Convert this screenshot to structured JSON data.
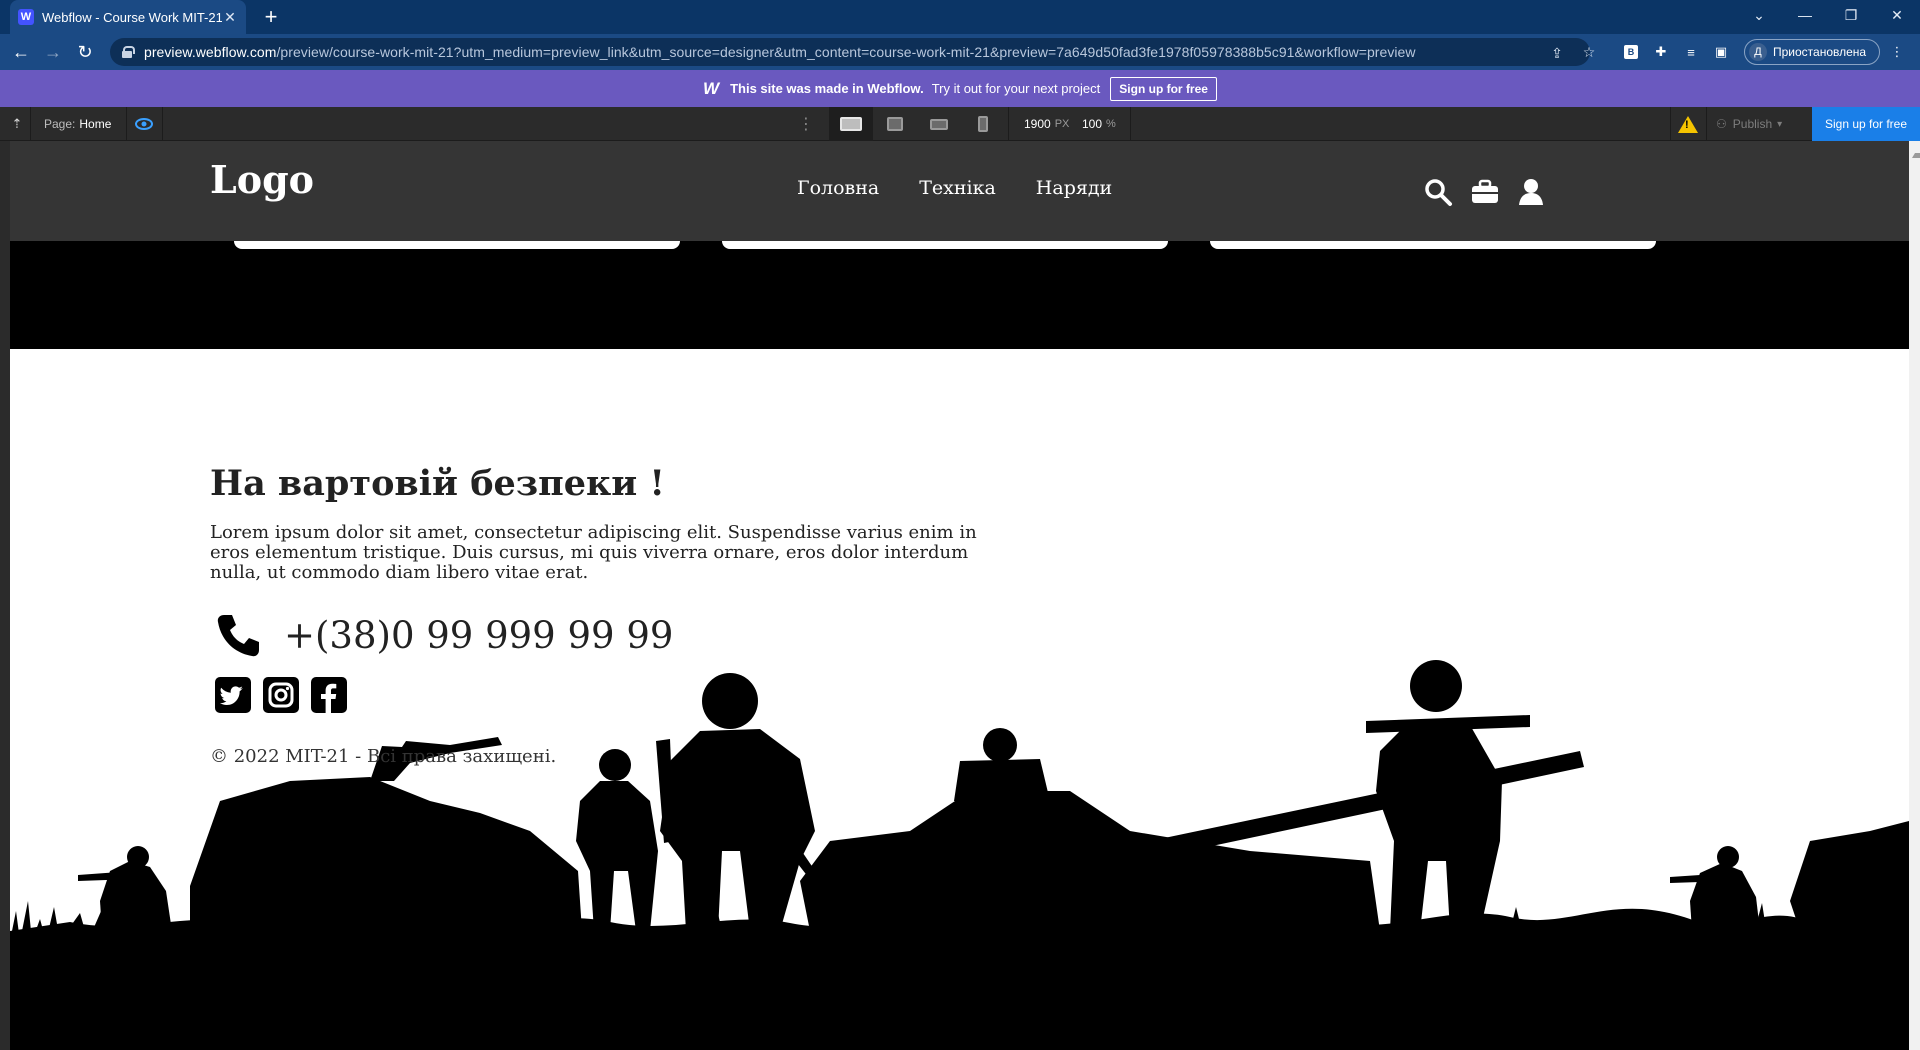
{
  "browser": {
    "tab_title": "Webflow - Course Work MIT-21",
    "tab_favicon": "W",
    "url_host": "preview.webflow.com",
    "url_rest": "/preview/course-work-mit-21?utm_medium=preview_link&utm_source=designer&utm_content=course-work-mit-21&preview=7a649d50fad3fe1978f05978388b5c91&workflow=preview",
    "profile_initial": "Д",
    "profile_label": "Приостановлена"
  },
  "webflow_banner": {
    "logo": "W",
    "made_in": "This site was made in Webflow.",
    "try_text": "Try it out for your next project",
    "signup": "Sign up for free"
  },
  "toolbar": {
    "page_prefix": "Page:",
    "page_name": "Home",
    "width_value": "1900",
    "width_unit": "PX",
    "zoom_value": "100",
    "zoom_unit": "%",
    "publish": "Publish",
    "signup": "Sign up for free"
  },
  "site": {
    "logo": "Logo",
    "nav": [
      {
        "label": "Головна"
      },
      {
        "label": "Техніка"
      },
      {
        "label": "Наряди"
      }
    ],
    "footer": {
      "heading": "На вартовій безпеки !",
      "text": "Lorem ipsum dolor sit amet, consectetur adipiscing elit. Suspendisse varius enim in eros elementum tristique. Duis cursus, mi quis viverra ornare, eros dolor interdum nulla, ut commodo diam libero vitae erat.",
      "phone": "+(38)0 99 999 99 99",
      "copyright": "© 2022 MIT-21 - Всі права захищені."
    }
  },
  "colors": {
    "browser_tabbar": "#0b3566",
    "browser_addrbar": "#1b4a84",
    "webflow_banner": "#6a59bf",
    "toolbar": "#2b2b2b",
    "site_nav": "#353535",
    "accent_blue": "#1a7fe8"
  },
  "icons": [
    "webflow-favicon-icon",
    "close-icon",
    "plus-icon",
    "chevron-down-icon",
    "minimize-icon",
    "restore-icon",
    "close-window-icon",
    "back-icon",
    "forward-icon",
    "reload-icon",
    "lock-icon",
    "share-icon",
    "star-icon",
    "extension-icon",
    "puzzle-icon",
    "media-icon",
    "sidebar-icon",
    "menu-dots-icon",
    "export-icon",
    "preview-eye-icon",
    "desktop-icon",
    "tablet-icon",
    "landscape-phone-icon",
    "phone-icon",
    "warning-icon",
    "search-icon",
    "briefcase-icon",
    "user-icon",
    "twitter-icon",
    "instagram-icon",
    "facebook-icon"
  ]
}
